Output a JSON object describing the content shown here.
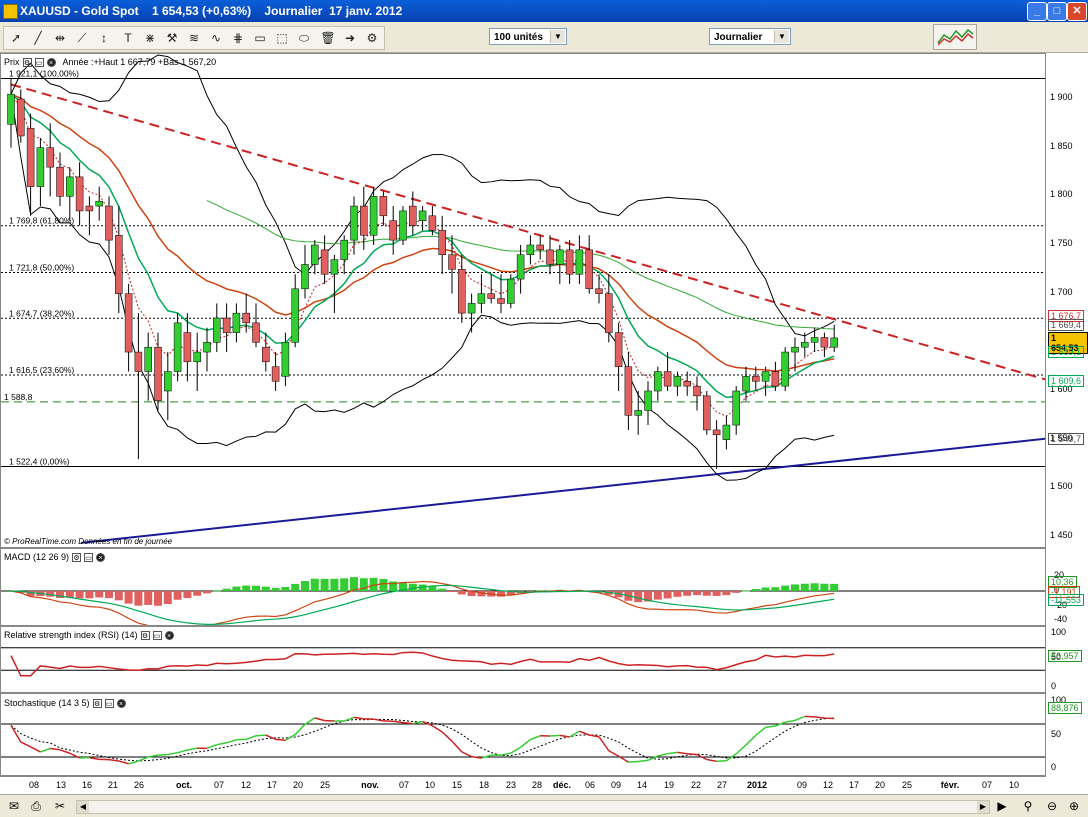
{
  "window": {
    "title": "XAUUSD - Gold Spot    1 654,53 (+0,63%)    Journalier  17 janv. 2012"
  },
  "toolbar": {
    "units": "100 unités",
    "period": "Journalier"
  },
  "price_panel": {
    "label": "Prix",
    "info": "Année :+Haut 1 667,79 +Bas 1 567,20",
    "watermark": "© ProRealTime.com  Données en fin de journée",
    "fib_labels": [
      "1 921,1 (100,00%)",
      "1 769,8 (61,80%)",
      "1 721,8 (50,00%)",
      "1 674,7 (38,20%)",
      "1 616,5 (23,60%)",
      "1 588,8",
      "1 522,4 (0,00%)"
    ],
    "y_ticks": [
      "1 900",
      "1 850",
      "1 800",
      "1 750",
      "1 700",
      "1 650",
      "1 600",
      "1 550",
      "1 500",
      "1 450"
    ],
    "value_boxes": [
      {
        "text": "1 676,7",
        "color": "#cc3333"
      },
      {
        "text": "1 669,4",
        "color": "#555555"
      },
      {
        "text": "1 654,53",
        "color": "#000000",
        "bg": "#f5c400"
      },
      {
        "text": "1 639,1",
        "color": "#00aa55"
      },
      {
        "text": "1 609,6",
        "color": "#00aa55"
      },
      {
        "text": "1 549,7",
        "color": "#555555"
      }
    ]
  },
  "macd_panel": {
    "label": "MACD (12 26 9)",
    "y_ticks": [
      "20",
      "0",
      "-20",
      "-40"
    ],
    "value_boxes": [
      "10,36",
      "-1,191",
      "-11,553"
    ]
  },
  "rsi_panel": {
    "label": "Relative strength index (RSI) (14)",
    "y_ticks": [
      "100",
      "50",
      "0"
    ],
    "value_box": "56,957"
  },
  "stoch_panel": {
    "label": "Stochastique (14 3 5)",
    "y_ticks": [
      "100",
      "50",
      "0"
    ],
    "value_box": "88,876"
  },
  "x_axis": {
    "labels": [
      "08",
      "13",
      "16",
      "21",
      "26",
      "oct.",
      "07",
      "12",
      "17",
      "20",
      "25",
      "nov.",
      "07",
      "10",
      "15",
      "18",
      "23",
      "28",
      "déc.",
      "06",
      "09",
      "14",
      "19",
      "22",
      "27",
      "2012",
      "09",
      "12",
      "17",
      "20",
      "25",
      "févr.",
      "07",
      "10"
    ],
    "bold": [
      "oct.",
      "nov.",
      "déc.",
      "2012",
      "févr."
    ]
  },
  "colors": {
    "up": "#33cc33",
    "down": "#e06060",
    "trend_red": "#cc2222",
    "trend_blue": "#1a1a99",
    "bollinger": "#000000",
    "sma_red": "#cc4411",
    "sma_green": "#00aa55",
    "sma_long_green": "#33aa33"
  },
  "chart_data": {
    "type": "candlestick",
    "title": "XAUUSD - Gold Spot",
    "ylim": [
      1440,
      1925
    ],
    "x": [
      "08",
      "13",
      "16",
      "21",
      "26",
      "oct.",
      "07",
      "12",
      "17",
      "20",
      "25",
      "nov.",
      "07",
      "10",
      "15",
      "18",
      "23",
      "28",
      "déc.",
      "06",
      "09",
      "14",
      "19",
      "22",
      "27",
      "2012",
      "09",
      "12",
      "17"
    ],
    "ohlc": [
      [
        1874,
        1921,
        1850,
        1905
      ],
      [
        1900,
        1910,
        1855,
        1862
      ],
      [
        1870,
        1885,
        1780,
        1810
      ],
      [
        1810,
        1860,
        1790,
        1850
      ],
      [
        1850,
        1875,
        1800,
        1830
      ],
      [
        1830,
        1845,
        1790,
        1800
      ],
      [
        1800,
        1830,
        1775,
        1820
      ],
      [
        1820,
        1835,
        1770,
        1785
      ],
      [
        1790,
        1800,
        1760,
        1785
      ],
      [
        1790,
        1810,
        1775,
        1795
      ],
      [
        1790,
        1800,
        1740,
        1755
      ],
      [
        1760,
        1790,
        1680,
        1700
      ],
      [
        1700,
        1710,
        1620,
        1640
      ],
      [
        1640,
        1680,
        1530,
        1620
      ],
      [
        1620,
        1660,
        1590,
        1645
      ],
      [
        1645,
        1660,
        1580,
        1590
      ],
      [
        1600,
        1640,
        1570,
        1620
      ],
      [
        1620,
        1680,
        1610,
        1670
      ],
      [
        1660,
        1680,
        1610,
        1630
      ],
      [
        1630,
        1660,
        1600,
        1640
      ],
      [
        1640,
        1665,
        1620,
        1650
      ],
      [
        1650,
        1690,
        1640,
        1675
      ],
      [
        1675,
        1690,
        1640,
        1660
      ],
      [
        1660,
        1690,
        1650,
        1680
      ],
      [
        1680,
        1700,
        1660,
        1670
      ],
      [
        1670,
        1690,
        1645,
        1650
      ],
      [
        1645,
        1660,
        1620,
        1630
      ],
      [
        1625,
        1640,
        1600,
        1610
      ],
      [
        1615,
        1660,
        1605,
        1650
      ],
      [
        1650,
        1720,
        1645,
        1705
      ],
      [
        1705,
        1750,
        1695,
        1730
      ],
      [
        1730,
        1755,
        1720,
        1750
      ],
      [
        1745,
        1760,
        1710,
        1720
      ],
      [
        1720,
        1740,
        1680,
        1735
      ],
      [
        1735,
        1760,
        1720,
        1755
      ],
      [
        1755,
        1800,
        1740,
        1790
      ],
      [
        1790,
        1810,
        1745,
        1760
      ],
      [
        1760,
        1810,
        1750,
        1800
      ],
      [
        1800,
        1805,
        1770,
        1780
      ],
      [
        1775,
        1790,
        1740,
        1755
      ],
      [
        1755,
        1790,
        1750,
        1785
      ],
      [
        1790,
        1805,
        1760,
        1770
      ],
      [
        1775,
        1790,
        1765,
        1785
      ],
      [
        1780,
        1790,
        1760,
        1765
      ],
      [
        1765,
        1780,
        1720,
        1740
      ],
      [
        1740,
        1760,
        1700,
        1725
      ],
      [
        1725,
        1740,
        1670,
        1680
      ],
      [
        1680,
        1700,
        1660,
        1690
      ],
      [
        1690,
        1720,
        1680,
        1700
      ],
      [
        1700,
        1720,
        1690,
        1695
      ],
      [
        1695,
        1720,
        1680,
        1690
      ],
      [
        1690,
        1720,
        1685,
        1715
      ],
      [
        1715,
        1750,
        1700,
        1740
      ],
      [
        1740,
        1760,
        1730,
        1750
      ],
      [
        1750,
        1760,
        1735,
        1745
      ],
      [
        1745,
        1760,
        1720,
        1730
      ],
      [
        1730,
        1750,
        1710,
        1745
      ],
      [
        1745,
        1755,
        1710,
        1720
      ],
      [
        1720,
        1760,
        1710,
        1745
      ],
      [
        1745,
        1760,
        1700,
        1705
      ],
      [
        1705,
        1720,
        1690,
        1700
      ],
      [
        1700,
        1720,
        1650,
        1660
      ],
      [
        1660,
        1670,
        1600,
        1625
      ],
      [
        1625,
        1640,
        1560,
        1575
      ],
      [
        1575,
        1600,
        1555,
        1580
      ],
      [
        1580,
        1610,
        1565,
        1600
      ],
      [
        1600,
        1625,
        1590,
        1620
      ],
      [
        1620,
        1640,
        1600,
        1605
      ],
      [
        1605,
        1620,
        1595,
        1615
      ],
      [
        1610,
        1620,
        1595,
        1605
      ],
      [
        1605,
        1615,
        1580,
        1595
      ],
      [
        1595,
        1600,
        1555,
        1560
      ],
      [
        1560,
        1570,
        1520,
        1555
      ],
      [
        1550,
        1575,
        1540,
        1565
      ],
      [
        1565,
        1605,
        1555,
        1600
      ],
      [
        1600,
        1625,
        1590,
        1615
      ],
      [
        1615,
        1625,
        1600,
        1610
      ],
      [
        1610,
        1625,
        1595,
        1620
      ],
      [
        1620,
        1630,
        1600,
        1605
      ],
      [
        1605,
        1645,
        1600,
        1640
      ],
      [
        1640,
        1655,
        1620,
        1645
      ],
      [
        1645,
        1660,
        1635,
        1650
      ],
      [
        1650,
        1665,
        1640,
        1655
      ],
      [
        1655,
        1660,
        1635,
        1645
      ],
      [
        1645,
        1668,
        1640,
        1654.53
      ]
    ]
  }
}
